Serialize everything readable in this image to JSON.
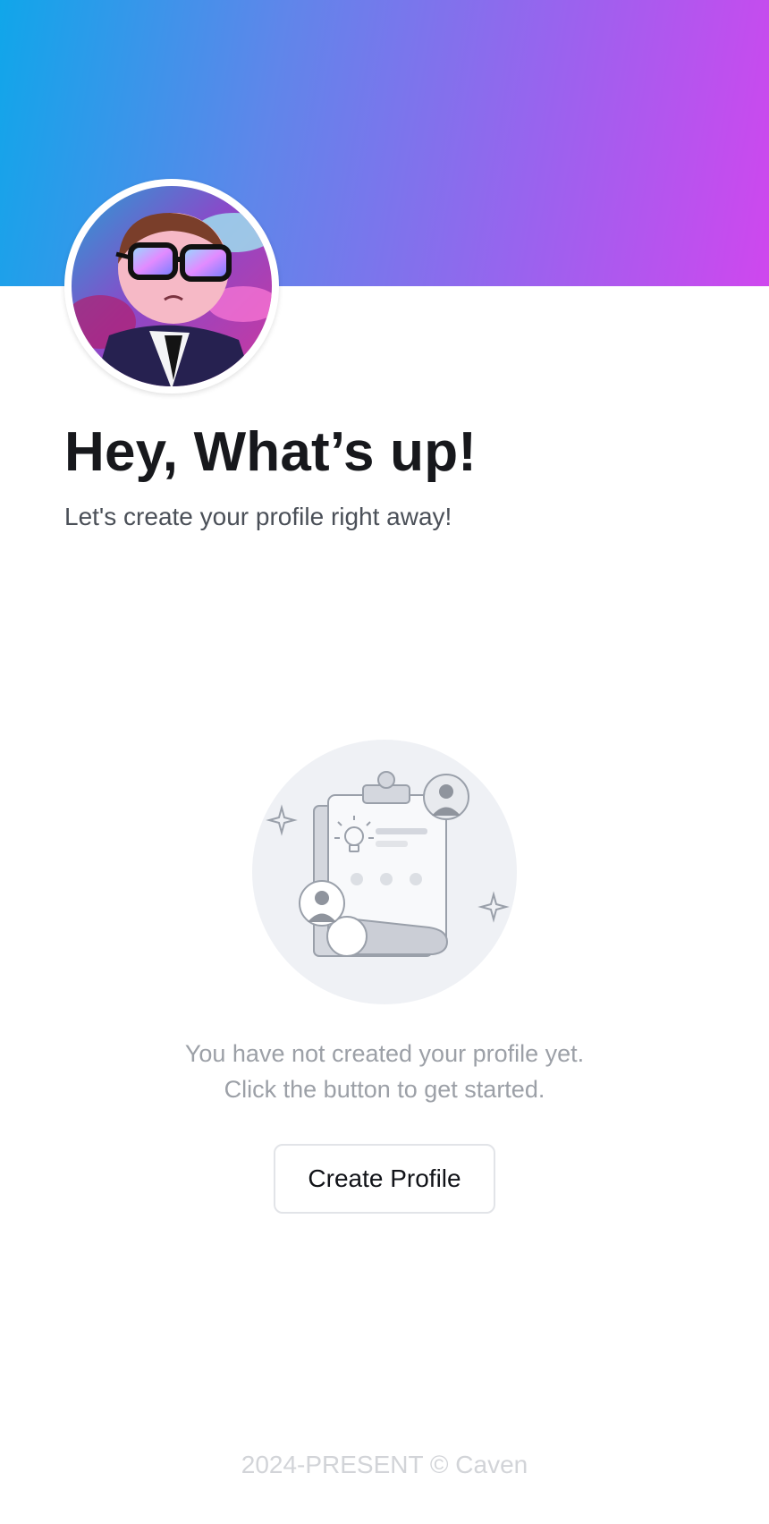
{
  "banner": {
    "gradient_start": "#10a6ea",
    "gradient_end": "#cf47ee"
  },
  "avatar": {
    "icon": "user-avatar-cartoon"
  },
  "header": {
    "title": "Hey, What’s up!",
    "subtitle": "Let's create your profile right away!"
  },
  "empty_state": {
    "illustration": "clipboard-profile-illustration",
    "line1": "You have not created your profile yet.",
    "line2": "Click the button to get started.",
    "button_label": "Create Profile"
  },
  "footer": {
    "text": "2024-PRESENT © Caven"
  }
}
